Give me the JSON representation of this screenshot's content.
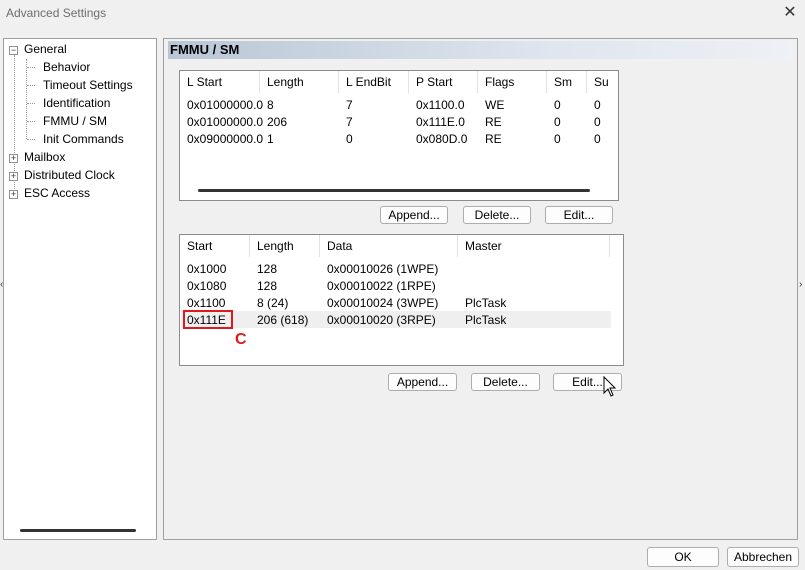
{
  "window": {
    "title": "Advanced Settings"
  },
  "tree": {
    "items": [
      {
        "label": "General",
        "expander": "⊟"
      },
      {
        "label": "Behavior"
      },
      {
        "label": "Timeout Settings"
      },
      {
        "label": "Identification"
      },
      {
        "label": "FMMU / SM"
      },
      {
        "label": "Init Commands"
      },
      {
        "label": "Mailbox",
        "expander": "⊞"
      },
      {
        "label": "Distributed Clock",
        "expander": "⊞"
      },
      {
        "label": "ESC Access",
        "expander": "⊞"
      }
    ]
  },
  "panel": {
    "title": "FMMU / SM",
    "fmmu": {
      "columns": [
        "L Start",
        "Length",
        "L EndBit",
        "P Start",
        "Flags",
        "Sm",
        "Su"
      ],
      "rows": [
        [
          "0x01000000.0",
          "8",
          "7",
          "0x1100.0",
          "WE",
          "0",
          "0"
        ],
        [
          "0x01000000.0",
          "206",
          "7",
          "0x111E.0",
          "RE",
          "0",
          "0"
        ],
        [
          "0x09000000.0",
          "1",
          "0",
          "0x080D.0",
          "RE",
          "0",
          "0"
        ]
      ],
      "buttons": {
        "append": "Append...",
        "delete": "Delete...",
        "edit": "Edit..."
      }
    },
    "sm": {
      "columns": [
        "Start",
        "Length",
        "Data",
        "Master"
      ],
      "rows": [
        [
          "0x1000",
          "128",
          "0x00010026 (1WPE)",
          ""
        ],
        [
          "0x1080",
          "128",
          "0x00010022 (1RPE)",
          ""
        ],
        [
          "0x1100",
          "8 (24)",
          "0x00010024 (3WPE)",
          "PlcTask"
        ],
        [
          "0x111E",
          "206 (618)",
          "0x00010020 (3RPE)",
          "PlcTask"
        ]
      ],
      "buttons": {
        "append": "Append...",
        "delete": "Delete...",
        "edit": "Edit..."
      }
    }
  },
  "annotation": {
    "label": "C"
  },
  "footer": {
    "ok": "OK",
    "cancel": "Abbrechen"
  }
}
